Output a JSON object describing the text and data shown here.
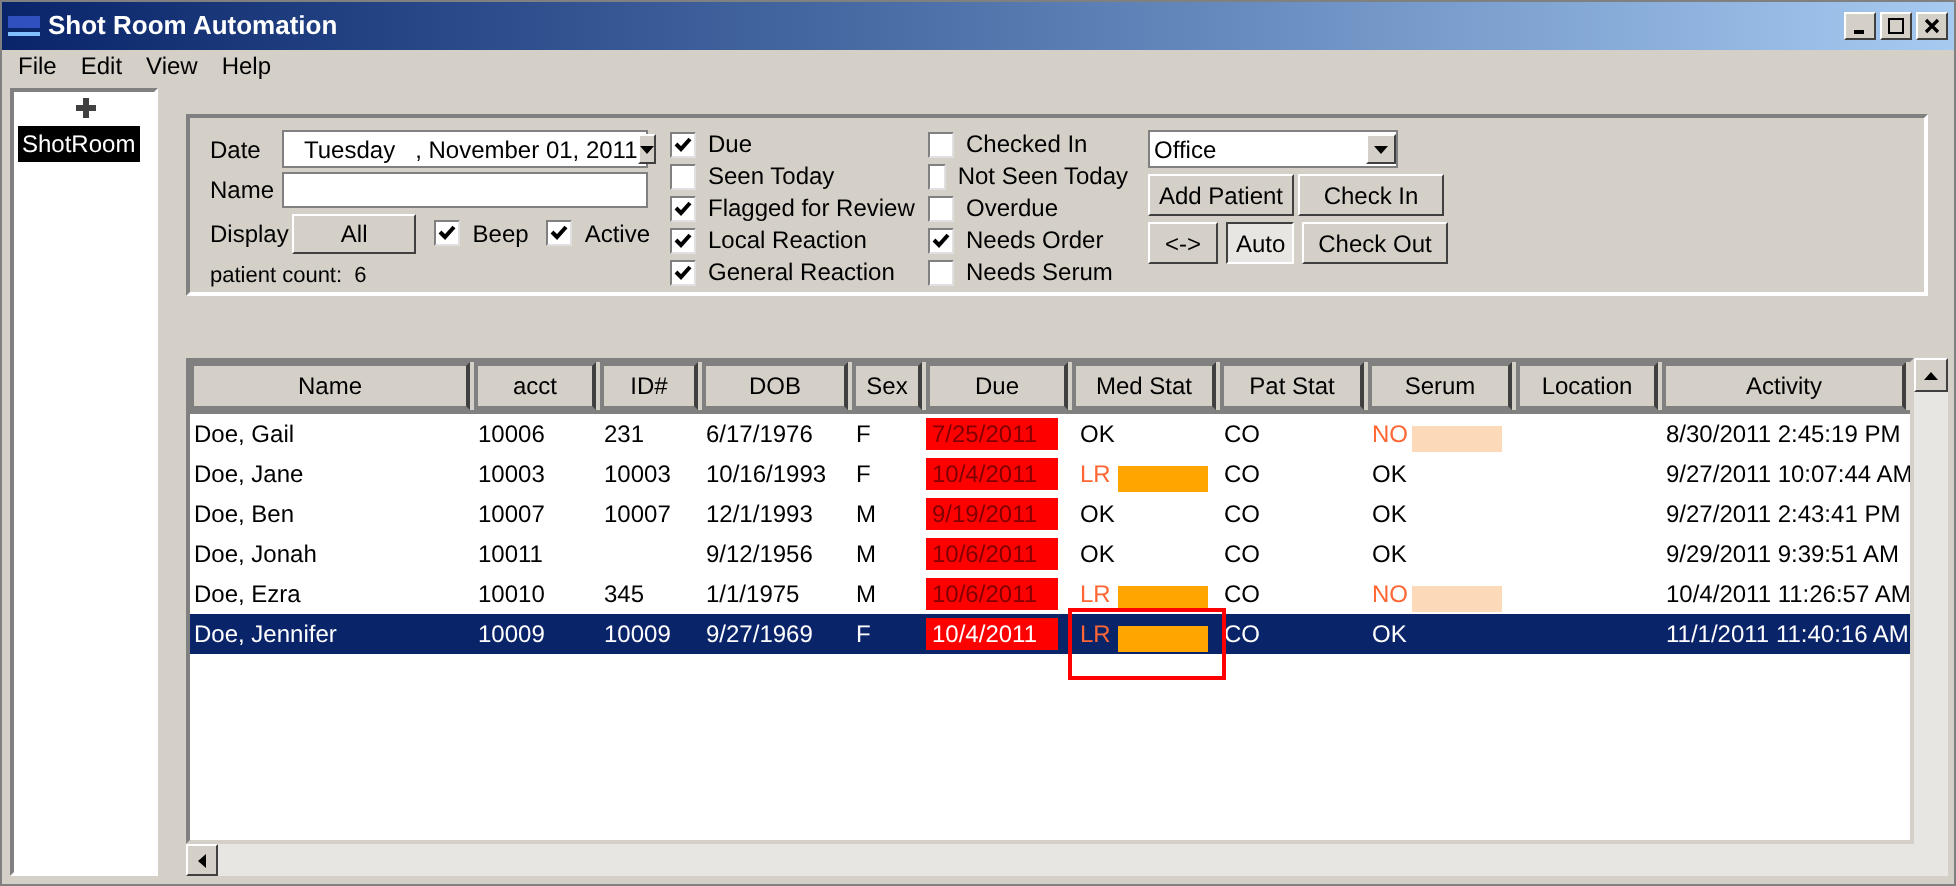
{
  "window": {
    "title": "Shot Room Automation"
  },
  "menu": [
    "File",
    "Edit",
    "View",
    "Help"
  ],
  "tree": {
    "items": [
      {
        "label": "ShotRoom",
        "selected": true
      }
    ]
  },
  "filters": {
    "date_label": "Date",
    "date_value": "Tuesday   , November 01, 2011",
    "name_label": "Name",
    "display_label": "Display",
    "display_button": "All",
    "toggles": [
      {
        "label": "Beep",
        "checked": true
      },
      {
        "label": "Active",
        "checked": true
      }
    ],
    "patient_count": "patient count:  6",
    "checks_1": [
      {
        "label": "Due",
        "checked": true
      },
      {
        "label": "Seen Today",
        "checked": false
      },
      {
        "label": "Flagged for Review",
        "checked": true
      },
      {
        "label": "Local Reaction",
        "checked": true
      },
      {
        "label": "General Reaction",
        "checked": true
      }
    ],
    "checks_2": [
      {
        "label": "Checked In",
        "checked": false
      },
      {
        "label": "Not Seen Today",
        "checked": false
      },
      {
        "label": "Overdue",
        "checked": false
      },
      {
        "label": "Needs Order",
        "checked": true
      },
      {
        "label": "Needs Serum",
        "checked": false
      }
    ],
    "location_select": "Office",
    "buttons": [
      {
        "label": "Add Patient"
      },
      {
        "label": "Check In"
      },
      {
        "label": "<->",
        "pressed": false
      },
      {
        "label": "Auto",
        "pressed": true
      },
      {
        "label": "Check Out"
      }
    ]
  },
  "table": {
    "columns": [
      "Name",
      "acct",
      "ID#",
      "DOB",
      "Sex",
      "Due",
      "Med Stat",
      "Pat Stat",
      "Serum",
      "Location",
      "Activity"
    ],
    "rows": [
      {
        "name": "Doe, Gail",
        "acct": "10006",
        "id": "231",
        "dob": "6/17/1976",
        "sex": "F",
        "due": "7/25/2011",
        "overdue": true,
        "med_stat": {
          "text": "OK",
          "alert": false,
          "marked": false
        },
        "pat_stat": "CO",
        "serum": {
          "text": "NO",
          "alert": true
        },
        "activity": "8/30/2011 2:45:19 PM",
        "selected": false
      },
      {
        "name": "Doe, Jane",
        "acct": "10003",
        "id": "10003",
        "dob": "10/16/1993",
        "sex": "F",
        "due": "10/4/2011",
        "overdue": true,
        "med_stat": {
          "text": "LR",
          "alert": true,
          "marked": false
        },
        "pat_stat": "CO",
        "serum": {
          "text": "OK",
          "alert": false
        },
        "activity": "9/27/2011 10:07:44 AM",
        "selected": false
      },
      {
        "name": "Doe, Ben",
        "acct": "10007",
        "id": "10007",
        "dob": "12/1/1993",
        "sex": "M",
        "due": "9/19/2011",
        "overdue": true,
        "med_stat": {
          "text": "OK",
          "alert": false,
          "marked": false
        },
        "pat_stat": "CO",
        "serum": {
          "text": "OK",
          "alert": false
        },
        "activity": "9/27/2011 2:43:41 PM",
        "selected": false
      },
      {
        "name": "Doe, Jonah",
        "acct": "10011",
        "dob": "9/12/1956",
        "sex": "M",
        "due": "10/6/2011",
        "overdue": true,
        "med_stat": {
          "text": "OK",
          "alert": false,
          "marked": false
        },
        "pat_stat": "CO",
        "serum": {
          "text": "OK",
          "alert": false
        },
        "activity": "9/29/2011 9:39:51 AM",
        "selected": false
      },
      {
        "name": "Doe, Ezra",
        "acct": "10010",
        "id": "345",
        "dob": "1/1/1975",
        "sex": "M",
        "due": "10/6/2011",
        "overdue": true,
        "med_stat": {
          "text": "LR",
          "alert": true,
          "marked": false
        },
        "pat_stat": "CO",
        "serum": {
          "text": "NO",
          "alert": true
        },
        "activity": "10/4/2011 11:26:57 AM",
        "selected": false
      },
      {
        "name": "Doe, Jennifer",
        "acct": "10009",
        "id": "10009",
        "dob": "9/27/1969",
        "sex": "F",
        "due": "10/4/2011",
        "overdue": true,
        "med_stat": {
          "text": "LR",
          "alert": true,
          "marked": true
        },
        "pat_stat": "CO",
        "serum": {
          "text": "OK",
          "alert": false
        },
        "activity": "11/1/2011 11:40:16 AM",
        "selected": true
      }
    ]
  }
}
